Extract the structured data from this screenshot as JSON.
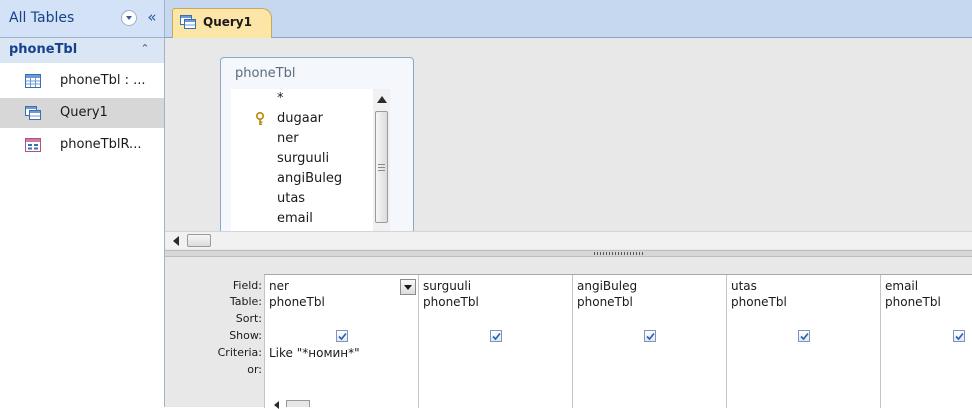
{
  "nav": {
    "header_title": "All Tables",
    "group_title": "phoneTbl",
    "items": [
      {
        "label": "phoneTbl : ...",
        "icon": "table-icon"
      },
      {
        "label": "Query1",
        "icon": "query-icon",
        "selected": true
      },
      {
        "label": "phoneTblR...",
        "icon": "report-icon"
      }
    ]
  },
  "tabs": [
    {
      "label": "Query1",
      "icon": "query-icon",
      "active": true
    }
  ],
  "table_box": {
    "title": "phoneTbl",
    "fields": [
      "*",
      "dugaar",
      "ner",
      "surguuli",
      "angiBuleg",
      "utas",
      "email"
    ],
    "primary_key": "dugaar"
  },
  "grid": {
    "row_labels": {
      "field": "Field:",
      "table": "Table:",
      "sort": "Sort:",
      "show": "Show:",
      "criteria": "Criteria:",
      "or": "or:"
    },
    "columns": [
      {
        "field": "ner",
        "table": "phoneTbl",
        "sort": "",
        "show": true,
        "criteria": "Like \"*номин*\"",
        "or": ""
      },
      {
        "field": "surguuli",
        "table": "phoneTbl",
        "sort": "",
        "show": true,
        "criteria": "",
        "or": ""
      },
      {
        "field": "angiBuleg",
        "table": "phoneTbl",
        "sort": "",
        "show": true,
        "criteria": "",
        "or": ""
      },
      {
        "field": "utas",
        "table": "phoneTbl",
        "sort": "",
        "show": true,
        "criteria": "",
        "or": ""
      },
      {
        "field": "email",
        "table": "phoneTbl",
        "sort": "",
        "show": true,
        "criteria": "",
        "or": ""
      }
    ]
  },
  "colors": {
    "nav_header_bg": "#d3e2f6",
    "nav_title": "#15428b",
    "tab_active_bg": "#fbe6a8",
    "pane_bg": "#e8e8e8"
  }
}
